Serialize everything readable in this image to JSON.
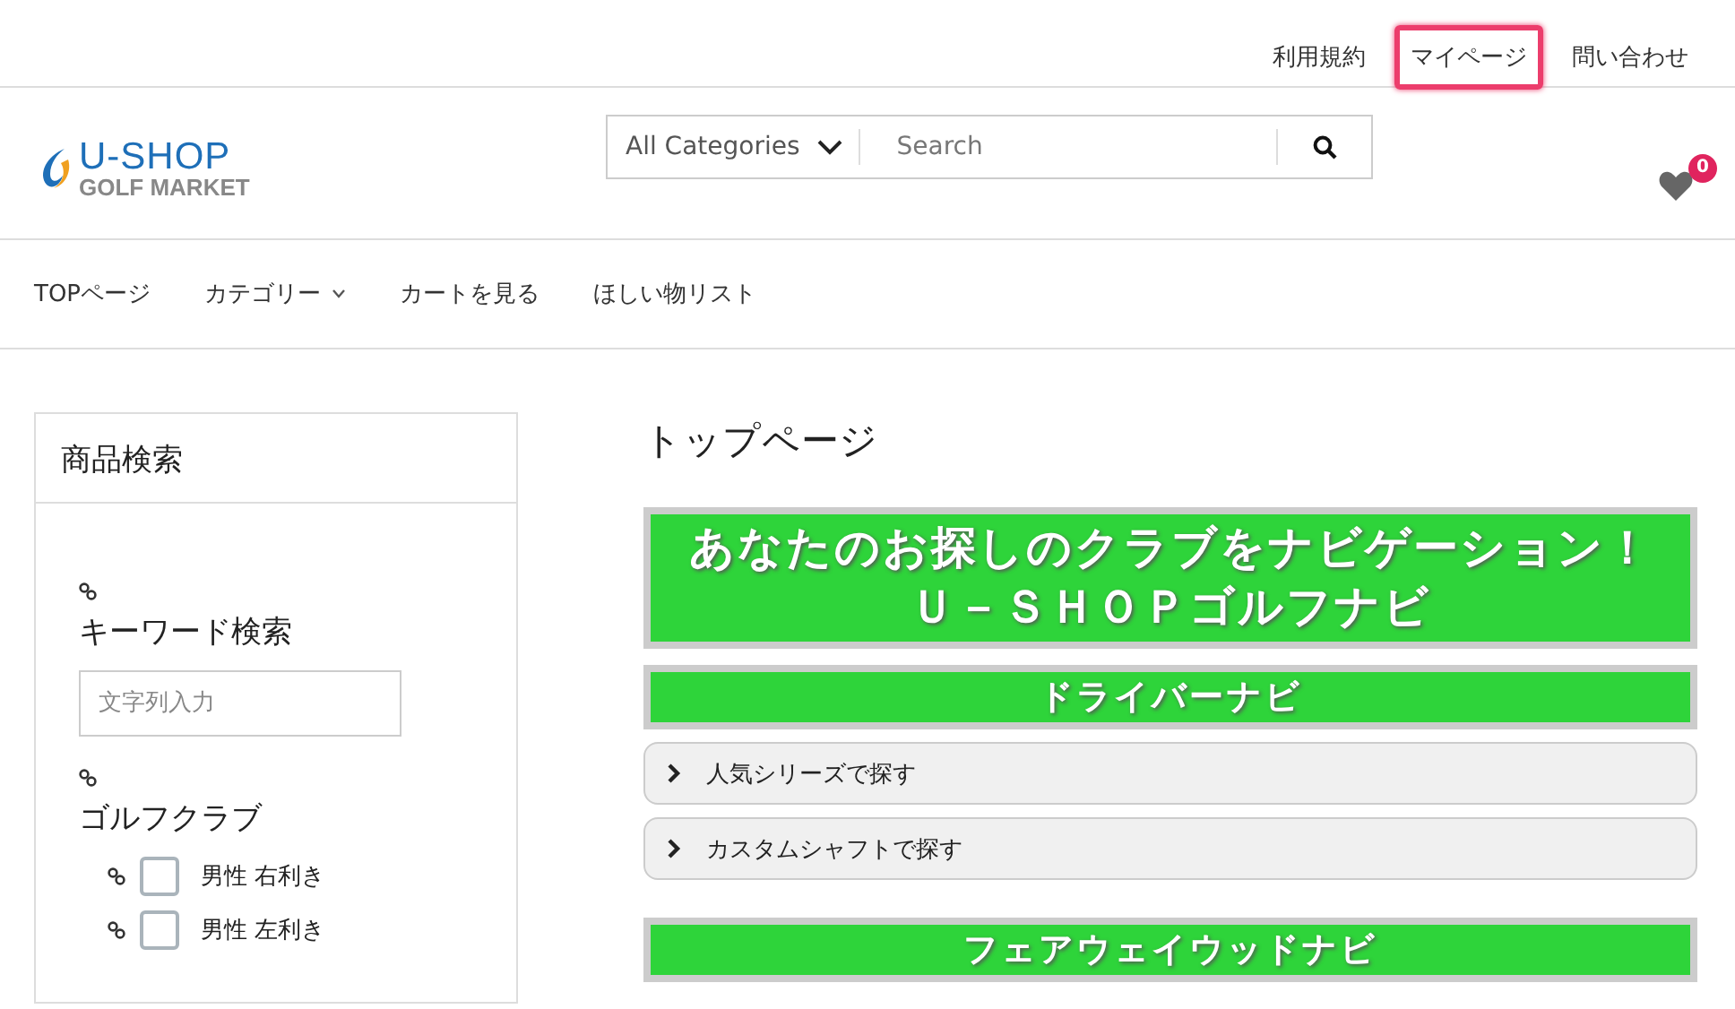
{
  "top_links": [
    {
      "label": "利用規約",
      "highlighted": false
    },
    {
      "label": "マイページ",
      "highlighted": true
    },
    {
      "label": "問い合わせ",
      "highlighted": false
    }
  ],
  "logo": {
    "title": "U-SHOP",
    "subtitle": "GOLF MARKET"
  },
  "search": {
    "category": "All Categories",
    "placeholder": "Search"
  },
  "wishlist": {
    "count": "0"
  },
  "nav": [
    {
      "label": "TOPページ",
      "dropdown": false
    },
    {
      "label": "カテゴリー",
      "dropdown": true
    },
    {
      "label": "カートを見る",
      "dropdown": false
    },
    {
      "label": "ほしい物リスト",
      "dropdown": false
    }
  ],
  "sidebar": {
    "title": "商品検索",
    "sections": [
      {
        "kind": "keyword",
        "label": "キーワード検索",
        "placeholder": "文字列入力"
      },
      {
        "kind": "checklist",
        "label": "ゴルフクラブ",
        "options": [
          {
            "label": "男性 右利き",
            "checked": false
          },
          {
            "label": "男性 左利き",
            "checked": false
          }
        ]
      }
    ]
  },
  "main": {
    "title": "トップページ",
    "blocks": [
      {
        "kind": "banner",
        "lines": [
          "あなたのお探しのクラブをナビゲーション！",
          "Ｕ－ＳＨＯＰゴルフナビ"
        ]
      },
      {
        "kind": "banner",
        "lines": [
          "ドライバーナビ"
        ]
      },
      {
        "kind": "accordion",
        "label": "人気シリーズで探す",
        "expanded": false
      },
      {
        "kind": "accordion",
        "label": "カスタムシャフトで探す",
        "expanded": false
      },
      {
        "kind": "banner",
        "lines": [
          "フェアウェイウッドナビ"
        ]
      }
    ]
  }
}
